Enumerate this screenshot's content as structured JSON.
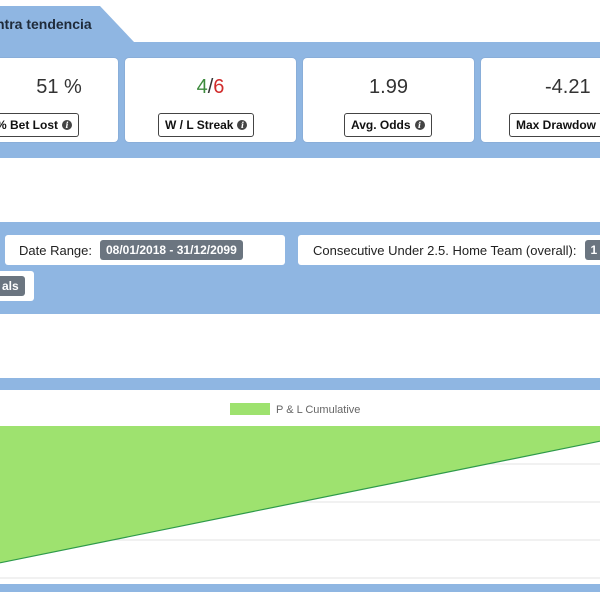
{
  "tab": {
    "title": "ntra tendencia"
  },
  "stats": [
    {
      "value": "51 %",
      "label": "% Bet Lost",
      "icon": "info-icon"
    },
    {
      "value_win": "4",
      "value_sep": "/",
      "value_loss": "6",
      "label": "W / L Streak",
      "icon": "info-icon"
    },
    {
      "value": "1.99",
      "label": "Avg. Odds",
      "icon": "info-icon"
    },
    {
      "value": "-4.21",
      "label": "Max Drawdow"
    }
  ],
  "filters": {
    "date_range_label": "Date Range:",
    "date_range_value": "08/01/2018 - 31/12/2099",
    "consecutive_label": "Consecutive Under 2.5. Home Team (overall):",
    "consecutive_value": "1",
    "second_row_value": "als"
  },
  "colors": {
    "band": "#8fb6e2",
    "win": "#3c8a3c",
    "loss": "#d12c2c",
    "area_fill": "#9ee26f",
    "area_line": "#2e9a4a"
  },
  "chart_data": {
    "type": "area",
    "title": "",
    "xlabel": "",
    "ylabel": "",
    "grid": true,
    "legend_placement": "top-center",
    "series": [
      {
        "name": "P & L Cumulative",
        "points": [
          [
            0,
            -0.9
          ],
          [
            1,
            -0.1
          ]
        ]
      }
    ],
    "ylim": [
      -1.0,
      0.0
    ]
  }
}
